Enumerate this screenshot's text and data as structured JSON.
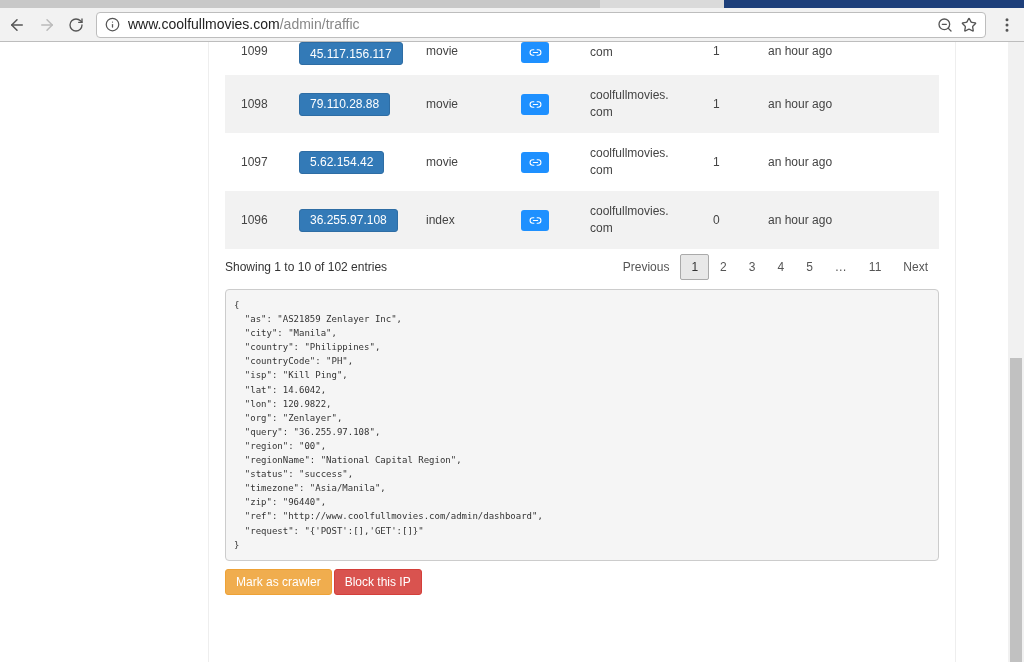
{
  "browser": {
    "url_host": "www.coolfullmovies.com",
    "url_path": "/admin/traffic"
  },
  "rows": [
    {
      "id": "1099",
      "ip": "45.117.156.117",
      "page": "movie",
      "domain": "com",
      "hits": "1",
      "time": "an hour ago"
    },
    {
      "id": "1098",
      "ip": "79.110.28.88",
      "page": "movie",
      "domain": "coolfullmovies.\ncom",
      "hits": "1",
      "time": "an hour ago"
    },
    {
      "id": "1097",
      "ip": "5.62.154.42",
      "page": "movie",
      "domain": "coolfullmovies.\ncom",
      "hits": "1",
      "time": "an hour ago"
    },
    {
      "id": "1096",
      "ip": "36.255.97.108",
      "page": "index",
      "domain": "coolfullmovies.\ncom",
      "hits": "0",
      "time": "an hour ago"
    }
  ],
  "info": "Showing 1 to 10 of 102 entries",
  "pagination": [
    {
      "label": "Previous",
      "selected": false
    },
    {
      "label": "1",
      "selected": true
    },
    {
      "label": "2",
      "selected": false
    },
    {
      "label": "3",
      "selected": false
    },
    {
      "label": "4",
      "selected": false
    },
    {
      "label": "5",
      "selected": false
    },
    {
      "label": "…",
      "selected": false
    },
    {
      "label": "11",
      "selected": false
    },
    {
      "label": "Next",
      "selected": false
    }
  ],
  "json_dump": "{\n  \"as\": \"AS21859 Zenlayer Inc\",\n  \"city\": \"Manila\",\n  \"country\": \"Philippines\",\n  \"countryCode\": \"PH\",\n  \"isp\": \"Kill Ping\",\n  \"lat\": 14.6042,\n  \"lon\": 120.9822,\n  \"org\": \"Zenlayer\",\n  \"query\": \"36.255.97.108\",\n  \"region\": \"00\",\n  \"regionName\": \"National Capital Region\",\n  \"status\": \"success\",\n  \"timezone\": \"Asia/Manila\",\n  \"zip\": \"96440\",\n  \"ref\": \"http://www.coolfullmovies.com/admin/dashboard\",\n  \"request\": \"{'POST':[],'GET':[]}\"\n}",
  "actions": [
    {
      "label": "Mark as crawler",
      "kind": "warning"
    },
    {
      "label": "Block this IP",
      "kind": "danger"
    }
  ]
}
